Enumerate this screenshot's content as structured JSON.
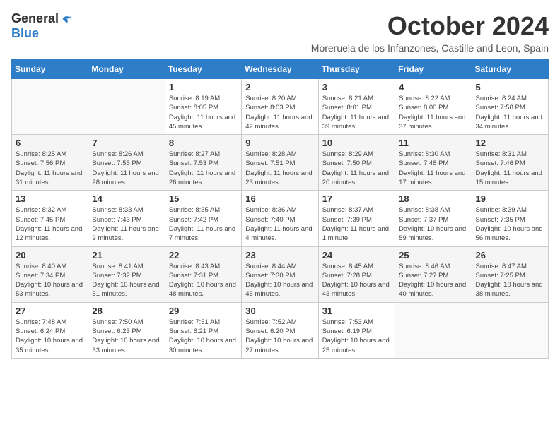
{
  "header": {
    "logo_general": "General",
    "logo_blue": "Blue",
    "month_title": "October 2024",
    "subtitle": "Moreruela de los Infanzones, Castille and Leon, Spain"
  },
  "weekdays": [
    "Sunday",
    "Monday",
    "Tuesday",
    "Wednesday",
    "Thursday",
    "Friday",
    "Saturday"
  ],
  "weeks": [
    [
      {
        "day": "",
        "info": ""
      },
      {
        "day": "",
        "info": ""
      },
      {
        "day": "1",
        "info": "Sunrise: 8:19 AM\nSunset: 8:05 PM\nDaylight: 11 hours and 45 minutes."
      },
      {
        "day": "2",
        "info": "Sunrise: 8:20 AM\nSunset: 8:03 PM\nDaylight: 11 hours and 42 minutes."
      },
      {
        "day": "3",
        "info": "Sunrise: 8:21 AM\nSunset: 8:01 PM\nDaylight: 11 hours and 39 minutes."
      },
      {
        "day": "4",
        "info": "Sunrise: 8:22 AM\nSunset: 8:00 PM\nDaylight: 11 hours and 37 minutes."
      },
      {
        "day": "5",
        "info": "Sunrise: 8:24 AM\nSunset: 7:58 PM\nDaylight: 11 hours and 34 minutes."
      }
    ],
    [
      {
        "day": "6",
        "info": "Sunrise: 8:25 AM\nSunset: 7:56 PM\nDaylight: 11 hours and 31 minutes."
      },
      {
        "day": "7",
        "info": "Sunrise: 8:26 AM\nSunset: 7:55 PM\nDaylight: 11 hours and 28 minutes."
      },
      {
        "day": "8",
        "info": "Sunrise: 8:27 AM\nSunset: 7:53 PM\nDaylight: 11 hours and 26 minutes."
      },
      {
        "day": "9",
        "info": "Sunrise: 8:28 AM\nSunset: 7:51 PM\nDaylight: 11 hours and 23 minutes."
      },
      {
        "day": "10",
        "info": "Sunrise: 8:29 AM\nSunset: 7:50 PM\nDaylight: 11 hours and 20 minutes."
      },
      {
        "day": "11",
        "info": "Sunrise: 8:30 AM\nSunset: 7:48 PM\nDaylight: 11 hours and 17 minutes."
      },
      {
        "day": "12",
        "info": "Sunrise: 8:31 AM\nSunset: 7:46 PM\nDaylight: 11 hours and 15 minutes."
      }
    ],
    [
      {
        "day": "13",
        "info": "Sunrise: 8:32 AM\nSunset: 7:45 PM\nDaylight: 11 hours and 12 minutes."
      },
      {
        "day": "14",
        "info": "Sunrise: 8:33 AM\nSunset: 7:43 PM\nDaylight: 11 hours and 9 minutes."
      },
      {
        "day": "15",
        "info": "Sunrise: 8:35 AM\nSunset: 7:42 PM\nDaylight: 11 hours and 7 minutes."
      },
      {
        "day": "16",
        "info": "Sunrise: 8:36 AM\nSunset: 7:40 PM\nDaylight: 11 hours and 4 minutes."
      },
      {
        "day": "17",
        "info": "Sunrise: 8:37 AM\nSunset: 7:39 PM\nDaylight: 11 hours and 1 minute."
      },
      {
        "day": "18",
        "info": "Sunrise: 8:38 AM\nSunset: 7:37 PM\nDaylight: 10 hours and 59 minutes."
      },
      {
        "day": "19",
        "info": "Sunrise: 8:39 AM\nSunset: 7:35 PM\nDaylight: 10 hours and 56 minutes."
      }
    ],
    [
      {
        "day": "20",
        "info": "Sunrise: 8:40 AM\nSunset: 7:34 PM\nDaylight: 10 hours and 53 minutes."
      },
      {
        "day": "21",
        "info": "Sunrise: 8:41 AM\nSunset: 7:32 PM\nDaylight: 10 hours and 51 minutes."
      },
      {
        "day": "22",
        "info": "Sunrise: 8:43 AM\nSunset: 7:31 PM\nDaylight: 10 hours and 48 minutes."
      },
      {
        "day": "23",
        "info": "Sunrise: 8:44 AM\nSunset: 7:30 PM\nDaylight: 10 hours and 45 minutes."
      },
      {
        "day": "24",
        "info": "Sunrise: 8:45 AM\nSunset: 7:28 PM\nDaylight: 10 hours and 43 minutes."
      },
      {
        "day": "25",
        "info": "Sunrise: 8:46 AM\nSunset: 7:27 PM\nDaylight: 10 hours and 40 minutes."
      },
      {
        "day": "26",
        "info": "Sunrise: 8:47 AM\nSunset: 7:25 PM\nDaylight: 10 hours and 38 minutes."
      }
    ],
    [
      {
        "day": "27",
        "info": "Sunrise: 7:48 AM\nSunset: 6:24 PM\nDaylight: 10 hours and 35 minutes."
      },
      {
        "day": "28",
        "info": "Sunrise: 7:50 AM\nSunset: 6:23 PM\nDaylight: 10 hours and 33 minutes."
      },
      {
        "day": "29",
        "info": "Sunrise: 7:51 AM\nSunset: 6:21 PM\nDaylight: 10 hours and 30 minutes."
      },
      {
        "day": "30",
        "info": "Sunrise: 7:52 AM\nSunset: 6:20 PM\nDaylight: 10 hours and 27 minutes."
      },
      {
        "day": "31",
        "info": "Sunrise: 7:53 AM\nSunset: 6:19 PM\nDaylight: 10 hours and 25 minutes."
      },
      {
        "day": "",
        "info": ""
      },
      {
        "day": "",
        "info": ""
      }
    ]
  ]
}
